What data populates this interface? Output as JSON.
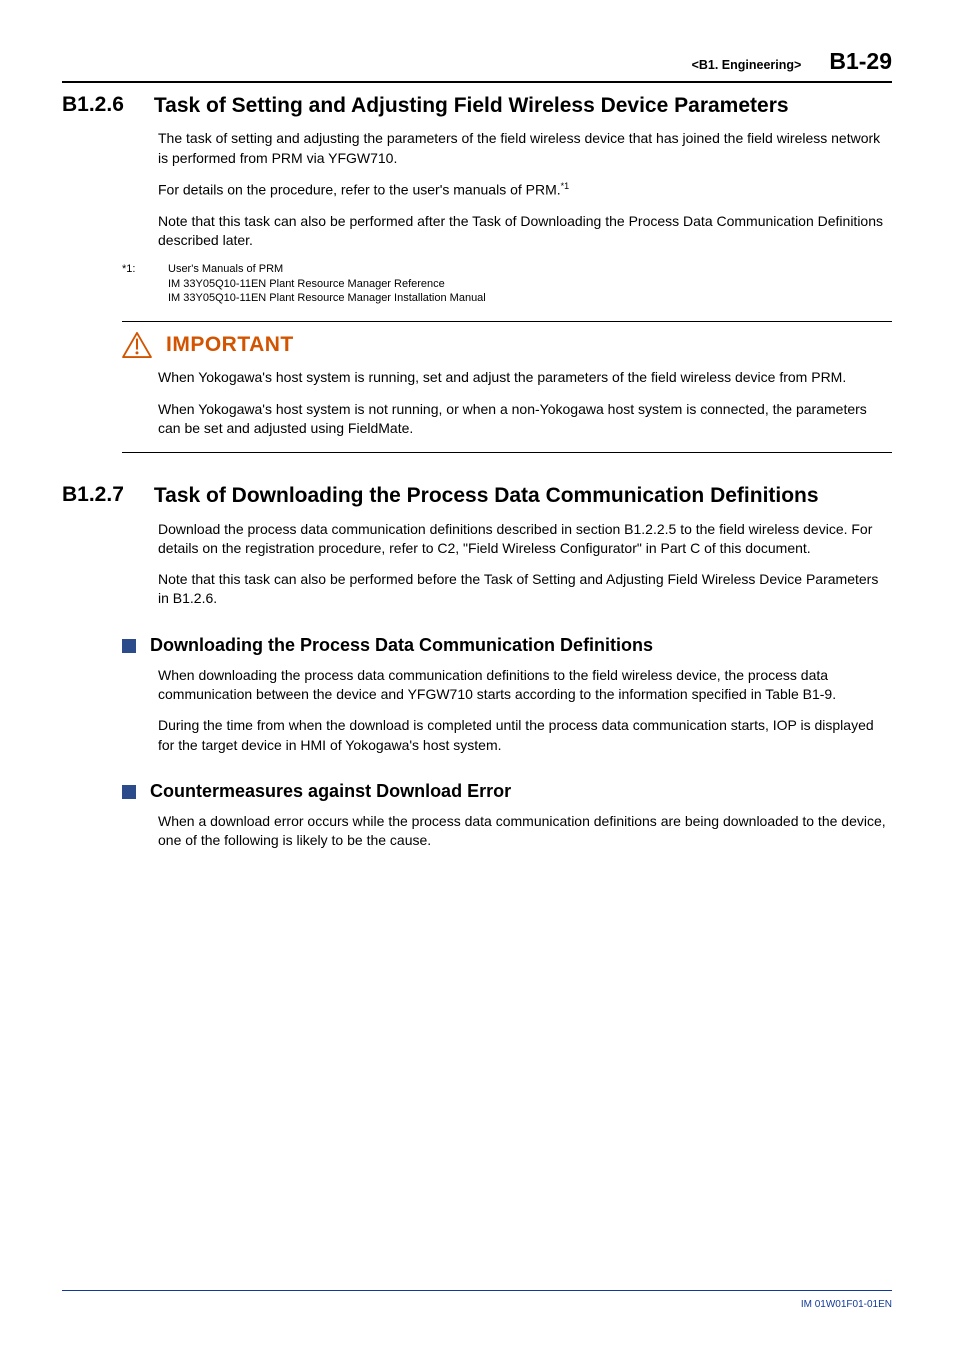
{
  "header": {
    "breadcrumb": "<B1.  Engineering>",
    "pageNumber": "B1-29"
  },
  "section1": {
    "num": "B1.2.6",
    "title": "Task of Setting and Adjusting Field Wireless Device Parameters",
    "p1": "The task of setting and adjusting the parameters of the field wireless device that has joined the field wireless network is performed from PRM via YFGW710.",
    "p2a": "For details on the procedure, refer to the user's manuals of PRM.",
    "p2sup": "*1",
    "p3": "Note that this task can also be performed after the Task of Downloading the Process Data Communication Definitions described later.",
    "fnLabel": "*1:",
    "fnLine1": "User's Manuals of PRM",
    "fnLine2": "IM 33Y05Q10-11EN Plant Resource Manager Reference",
    "fnLine3": "IM 33Y05Q10-11EN Plant Resource Manager Installation Manual"
  },
  "important": {
    "label": "IMPORTANT",
    "p1": "When Yokogawa's host system is running, set and adjust the parameters of the field wireless device from PRM.",
    "p2": "When Yokogawa's host system is not running, or when a non-Yokogawa host system is connected, the parameters can be set and adjusted using FieldMate."
  },
  "section2": {
    "num": "B1.2.7",
    "title": "Task of Downloading the Process Data Communication Definitions",
    "p1": "Download the process data communication definitions described in section B1.2.2.5 to the field wireless device. For details on the registration procedure, refer to C2, \"Field Wireless Configurator\" in Part C of this document.",
    "p2": "Note that this task can also be performed before the Task of Setting and Adjusting Field Wireless Device Parameters in B1.2.6."
  },
  "sub1": {
    "title": "Downloading the Process Data Communication Definitions",
    "p1": "When downloading the process data communication definitions to the field wireless device, the process data communication between the device and YFGW710 starts according to the information specified in Table B1-9.",
    "p2": "During the time from when the download is completed until the process data communication starts, IOP is displayed for the target device in HMI of Yokogawa's host system."
  },
  "sub2": {
    "title": "Countermeasures against Download Error",
    "p1": "When a download error occurs while the process data communication definitions are being downloaded to the device, one of the following is likely to be the cause."
  },
  "footer": {
    "doc": "IM 01W01F01-01EN"
  }
}
